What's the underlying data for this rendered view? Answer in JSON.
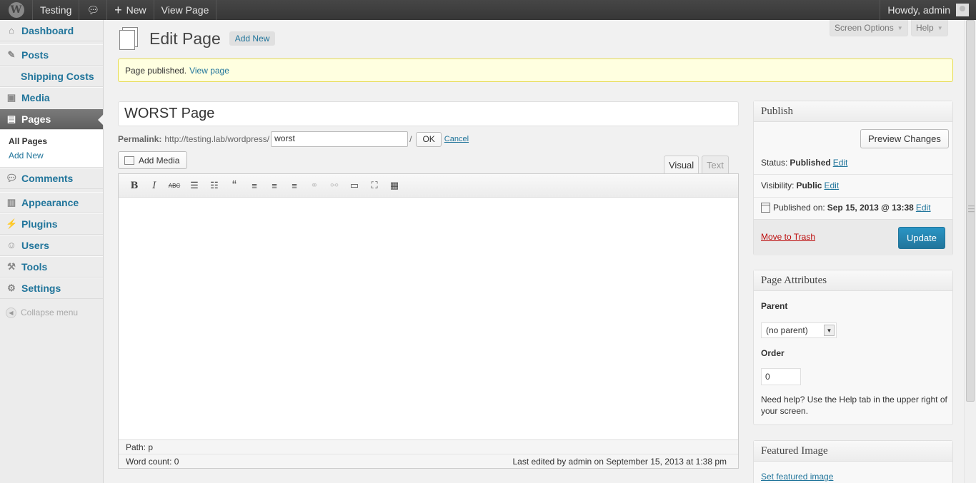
{
  "adminbar": {
    "site_name": "Testing",
    "new_label": "New",
    "view_page": "View Page",
    "howdy": "Howdy, admin"
  },
  "sidebar": {
    "items": [
      {
        "label": "Dashboard",
        "icon": "dashboard-icon"
      },
      {
        "label": "Posts",
        "icon": "pin-icon"
      },
      {
        "label": "Shipping Costs",
        "icon": ""
      },
      {
        "label": "Media",
        "icon": "media-icon"
      },
      {
        "label": "Pages",
        "icon": "pages-icon"
      },
      {
        "label": "Comments",
        "icon": "comment-icon"
      },
      {
        "label": "Appearance",
        "icon": "appearance-icon"
      },
      {
        "label": "Plugins",
        "icon": "plugin-icon"
      },
      {
        "label": "Users",
        "icon": "users-icon"
      },
      {
        "label": "Tools",
        "icon": "tools-icon"
      },
      {
        "label": "Settings",
        "icon": "settings-icon"
      }
    ],
    "pages_sub": [
      "All Pages",
      "Add New"
    ],
    "collapse": "Collapse menu"
  },
  "screen_options": "Screen Options",
  "help": "Help",
  "heading": {
    "title": "Edit Page",
    "add_new": "Add New"
  },
  "notice": {
    "text": "Page published.",
    "link": "View page"
  },
  "post": {
    "title": "WORST Page",
    "permalink_label": "Permalink:",
    "permalink_base": "http://testing.lab/wordpress/",
    "slug": "worst",
    "slash": "/",
    "ok": "OK",
    "cancel": "Cancel"
  },
  "editor": {
    "add_media": "Add Media",
    "tab_visual": "Visual",
    "tab_text": "Text",
    "path": "Path: p",
    "word_count": "Word count: 0",
    "last_edited": "Last edited by admin on September 15, 2013 at 1:38 pm",
    "toolbar": [
      {
        "glyph": "B",
        "icon": "bold-icon"
      },
      {
        "glyph": "I",
        "icon": "italic-icon"
      },
      {
        "glyph": "ABC",
        "icon": "strikethrough-icon"
      },
      {
        "glyph": "☰",
        "icon": "bullet-list-icon"
      },
      {
        "glyph": "☷",
        "icon": "numbered-list-icon"
      },
      {
        "glyph": "“",
        "icon": "blockquote-icon"
      },
      {
        "glyph": "≡",
        "icon": "align-left-icon"
      },
      {
        "glyph": "≡",
        "icon": "align-center-icon"
      },
      {
        "glyph": "≡",
        "icon": "align-right-icon"
      },
      {
        "glyph": "⚭",
        "icon": "link-icon"
      },
      {
        "glyph": "⚯",
        "icon": "unlink-icon"
      },
      {
        "glyph": "▭",
        "icon": "more-tag-icon"
      },
      {
        "glyph": "⛶",
        "icon": "fullscreen-icon"
      },
      {
        "glyph": "▦",
        "icon": "kitchen-sink-icon"
      }
    ]
  },
  "publish": {
    "title": "Publish",
    "preview": "Preview Changes",
    "status_label": "Status:",
    "status_value": "Published",
    "visibility_label": "Visibility:",
    "visibility_value": "Public",
    "published_label": "Published on:",
    "published_value": "Sep 15, 2013 @ 13:38",
    "edit": "Edit",
    "trash": "Move to Trash",
    "update": "Update"
  },
  "attributes": {
    "title": "Page Attributes",
    "parent_label": "Parent",
    "parent_value": "(no parent)",
    "order_label": "Order",
    "order_value": "0",
    "help_text": "Need help? Use the Help tab in the upper right of your screen."
  },
  "featured": {
    "title": "Featured Image",
    "link": "Set featured image"
  },
  "colors": {
    "link": "#21759b",
    "accent": "#2a95c5",
    "trash": "#bc0b0b",
    "notice_bg": "#ffffe0"
  }
}
